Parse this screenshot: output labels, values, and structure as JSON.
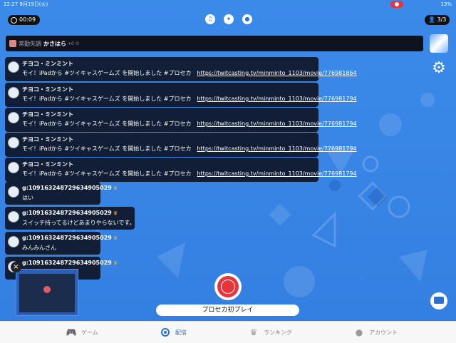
{
  "status_bar": {
    "time_date": "22:27 9月19日(火)",
    "battery": "13%"
  },
  "header": {
    "timer": "00:09",
    "viewers": "3/3",
    "icons": [
      "headset-icon",
      "effect-icon",
      "drop-icon"
    ]
  },
  "telop": {
    "prefix": "常勤失調",
    "name": "かさはら",
    "suffix": "+0 ©"
  },
  "comments": [
    {
      "name": "チヨコ・ミンミント",
      "text": "モイ！iPadから #ツイキャスゲームズ を開始しました #プロセカ",
      "link": "https://twitcasting.tv/minminto_1103/movie/776981864"
    },
    {
      "name": "チヨコ・ミンミント",
      "text": "モイ！iPadから #ツイキャスゲームズ を開始しました #プロセカ",
      "link": "https://twitcasting.tv/minminto_1103/movie/776981794"
    },
    {
      "name": "チヨコ・ミンミント",
      "text": "モイ！iPadから #ツイキャスゲームズ を開始しました #プロセカ",
      "link": "https://twitcasting.tv/minminto_1103/movie/776981794"
    },
    {
      "name": "チヨコ・ミンミント",
      "text": "モイ！iPadから #ツイキャスゲームズ を開始しました #プロセカ",
      "link": "https://twitcasting.tv/minminto_1103/movie/776981794"
    },
    {
      "name": "チヨコ・ミンミント",
      "text": "モイ！iPadから #ツイキャスゲームズ を開始しました #プロセカ",
      "link": "https://twitcasting.tv/minminto_1103/movie/776981794"
    },
    {
      "name": "g:1091632487296349050​29",
      "text": "はい",
      "link": ""
    },
    {
      "name": "g:109163248729634905029",
      "text": "スイッチ持ってるけどあまりやらないです。",
      "link": ""
    },
    {
      "name": "g:109163248729634905029",
      "text": "みんみんさん",
      "link": ""
    },
    {
      "name": "g:109163248729634905029",
      "text": "",
      "link": ""
    }
  ],
  "broadcast_title": "プロセカ初プレイ",
  "tabs": [
    {
      "label": "ゲーム",
      "icon": "gamepad-icon"
    },
    {
      "label": "配信",
      "icon": "broadcast-icon"
    },
    {
      "label": "ランキング",
      "icon": "crown-icon"
    },
    {
      "label": "アカウント",
      "icon": "account-icon"
    }
  ],
  "colors": {
    "background": "#3a86e6",
    "record": "#e8343a",
    "accent": "#2c6fd0"
  }
}
